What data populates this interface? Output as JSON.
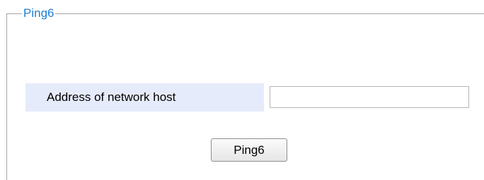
{
  "panel": {
    "legend": "Ping6"
  },
  "form": {
    "address_label": "Address of network host",
    "address_value": "",
    "ping_button_label": "Ping6"
  }
}
